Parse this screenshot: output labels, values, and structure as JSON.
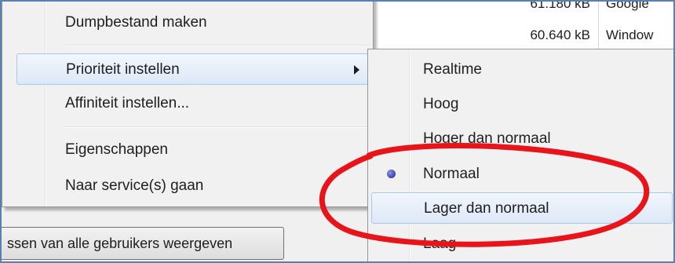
{
  "background": {
    "rows": [
      {
        "size": "61.180 kB",
        "description": "Google"
      },
      {
        "size": "60.640 kB",
        "description": "Window"
      }
    ],
    "show_all_button": "ssen van alle gebruikers weergeven"
  },
  "context_menu": {
    "items": [
      {
        "label": "Dumpbestand maken"
      },
      {
        "label": "Prioriteit instellen",
        "has_submenu": true,
        "highlighted": true
      },
      {
        "label": "Affiniteit instellen..."
      },
      {
        "label": "Eigenschappen"
      },
      {
        "label": "Naar service(s) gaan"
      }
    ]
  },
  "priority_submenu": {
    "items": [
      {
        "label": "Realtime"
      },
      {
        "label": "Hoog"
      },
      {
        "label": "Hoger dan normaal"
      },
      {
        "label": "Normaal",
        "selected": true
      },
      {
        "label": "Lager dan normaal",
        "highlighted": true
      },
      {
        "label": "Laag"
      }
    ]
  },
  "colors": {
    "annotation": "#e8141a",
    "highlight_border": "#a8c8ee",
    "radio_dot": "#3a3fae",
    "frame": "#5b7fb0"
  },
  "icons": {
    "submenu_arrow": "chevron-right-icon",
    "selected_marker": "radio-dot-icon"
  }
}
